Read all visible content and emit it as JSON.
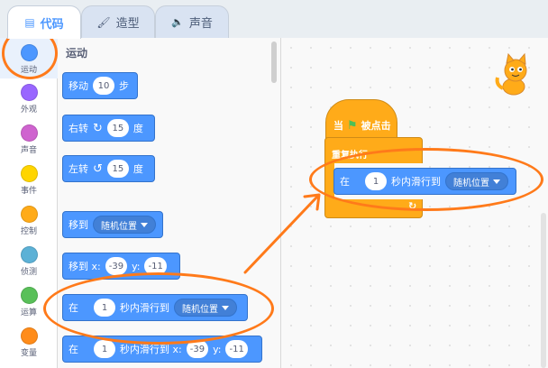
{
  "tabs": [
    {
      "label": "代码",
      "icon": "code-icon"
    },
    {
      "label": "造型",
      "icon": "brush-icon"
    },
    {
      "label": "声音",
      "icon": "speaker-icon"
    }
  ],
  "categories": [
    {
      "label": "运动",
      "color": "#4c97ff"
    },
    {
      "label": "外观",
      "color": "#9966ff"
    },
    {
      "label": "声音",
      "color": "#cf63cf"
    },
    {
      "label": "事件",
      "color": "#ffd500"
    },
    {
      "label": "控制",
      "color": "#ffab19"
    },
    {
      "label": "侦测",
      "color": "#5cb1d6"
    },
    {
      "label": "运算",
      "color": "#59c059"
    },
    {
      "label": "变量",
      "color": "#ff8c1a"
    }
  ],
  "palette": {
    "title": "运动",
    "move": {
      "prefix": "移动",
      "steps": "10",
      "suffix": "步"
    },
    "turn_right": {
      "prefix": "右转",
      "degrees": "15",
      "suffix": "度"
    },
    "turn_left": {
      "prefix": "左转",
      "degrees": "15",
      "suffix": "度"
    },
    "goto": {
      "prefix": "移到",
      "target": "随机位置"
    },
    "goto_xy": {
      "prefix": "移到 x:",
      "x": "-39",
      "ylabel": "y:",
      "y": "-11"
    },
    "glide_to": {
      "prefix": "在",
      "secs": "1",
      "mid": "秒内滑行到",
      "target": "随机位置"
    },
    "glide_xy": {
      "prefix": "在",
      "secs": "1",
      "mid": "秒内滑行到 x:",
      "x": "-39",
      "ylabel": "y:",
      "y": "-11"
    }
  },
  "script": {
    "hat_label": "当",
    "hat_suffix": "被点击",
    "loop_label": "重复执行",
    "loop_arrow": "↻",
    "glide": {
      "prefix": "在",
      "secs": "1",
      "mid": "秒内滑行到",
      "target": "随机位置"
    }
  },
  "colors": {
    "motion": "#4c97ff",
    "events": "#ffab19",
    "annotation": "#ff7a1a"
  }
}
